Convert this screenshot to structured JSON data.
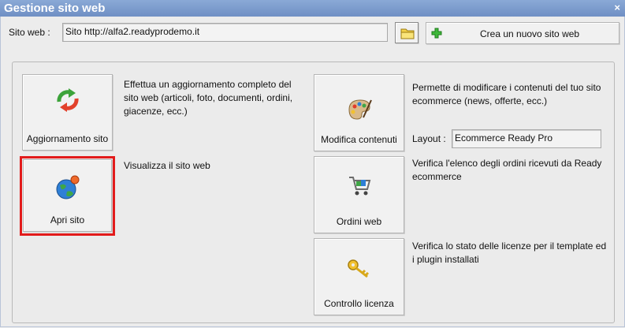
{
  "window": {
    "title": "Gestione sito web",
    "close": "×"
  },
  "site": {
    "label": "Sito web :",
    "value": "Sito http://alfa2.readyprodemo.it",
    "new_button": "Crea un nuovo sito web"
  },
  "left": {
    "update": {
      "label": "Aggiornamento sito",
      "description": "Effettua un aggiornamento completo del sito web (articoli, foto, documenti, ordini, giacenze, ecc.)",
      "icon": "refresh-arrows-icon"
    },
    "open": {
      "label": "Apri sito",
      "description": "Visualizza il sito web",
      "icon": "globe-icon"
    }
  },
  "right": {
    "modify": {
      "label": "Modifica contenuti",
      "description": "Permette di modificare i contenuti del tuo sito ecommerce (news, offerte, ecc.)",
      "icon": "palette-icon"
    },
    "layout": {
      "label": "Layout :",
      "value": "Ecommerce Ready Pro"
    },
    "orders": {
      "label": "Ordini web",
      "description": "Verifica l'elenco degli ordini ricevuti da Ready ecommerce",
      "icon": "cart-icon"
    },
    "license": {
      "label": "Controllo licenza",
      "description": "Verifica lo stato delle licenze per il template ed i plugin installati",
      "icon": "key-icon"
    }
  },
  "colors": {
    "title_bar": "#7b9acd",
    "highlight": "#e21b1b"
  }
}
